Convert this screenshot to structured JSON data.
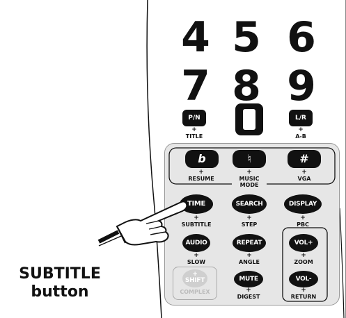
{
  "digits": [
    "4",
    "5",
    "6",
    "7",
    "8",
    "9",
    "0"
  ],
  "top_buttons": {
    "pn": "P/N",
    "pn_sub": "TITLE",
    "lr": "L/R",
    "lr_sub": "A-B"
  },
  "panel_buttons": {
    "flat": "b",
    "natural": "♮",
    "sharp": "#",
    "resume": "RESUME",
    "music_mode": "MUSIC\nMODE",
    "vga": "VGA"
  },
  "ovals": {
    "time": "TIME",
    "search": "SEARCH",
    "display": "DISPLAY",
    "subtitle": "SUBTITLE",
    "step": "STEP",
    "pbc": "PBC",
    "audio": "AUDIO",
    "repeat": "REPEAT",
    "volplus": "VOL+",
    "slow": "SLOW",
    "angle": "ANGLE",
    "zoom": "ZOOM",
    "shift": "SHIFT",
    "complex": "COMPLEX",
    "mute": "MUTE",
    "volminus": "VOL-",
    "digest": "DIGEST",
    "return": "RETURN",
    "plus": "+"
  },
  "callout": {
    "line1": "SUBTITLE",
    "line2": "button"
  },
  "colors": {
    "ink": "#111111",
    "panel": "#e6e6e6",
    "shift_gray": "#cfcfcf"
  }
}
